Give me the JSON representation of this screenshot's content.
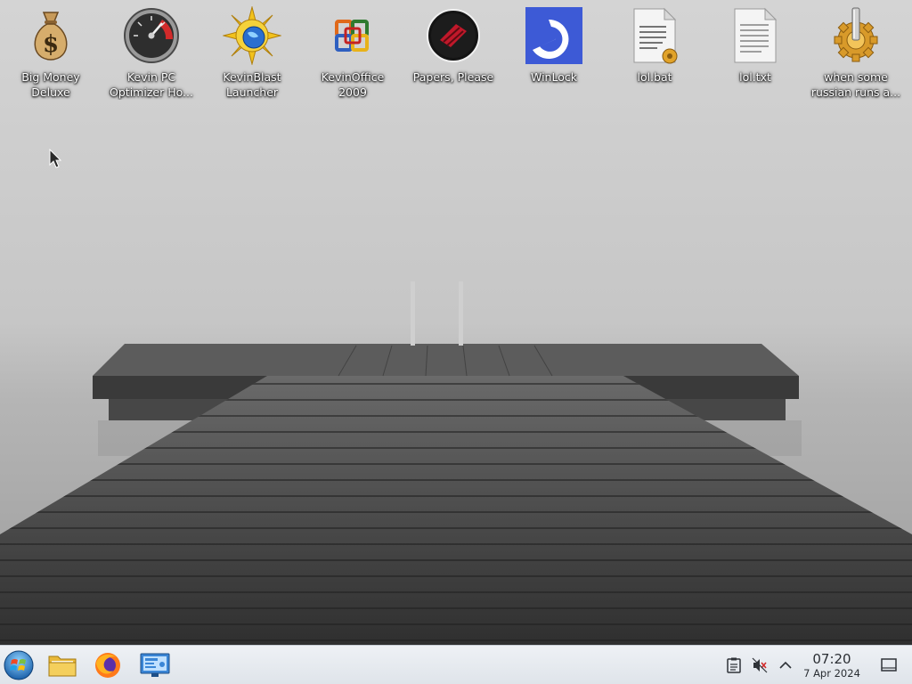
{
  "desktop": {
    "icons": [
      {
        "label": "Big Money\nDeluxe",
        "icon": "money-bag-icon"
      },
      {
        "label": "Kevin PC\nOptimizer Ho...",
        "icon": "speedometer-icon"
      },
      {
        "label": "KevinBlast\nLauncher",
        "icon": "sun-globe-icon"
      },
      {
        "label": "KevinOffice\n2009",
        "icon": "office-squares-icon"
      },
      {
        "label": "Papers, Please",
        "icon": "papers-please-seal-icon"
      },
      {
        "label": "WinLock",
        "icon": "winlock-icon"
      },
      {
        "label": "lol.bat",
        "icon": "batch-file-icon"
      },
      {
        "label": "lol.txt",
        "icon": "text-file-icon"
      },
      {
        "label": "when some\nrussian runs a...",
        "icon": "gear-icon"
      }
    ]
  },
  "taskbar": {
    "pinned": [
      {
        "name": "start-button",
        "icon": "windows-orb-icon"
      },
      {
        "name": "file-manager-button",
        "icon": "folder-icon"
      },
      {
        "name": "firefox-button",
        "icon": "firefox-icon"
      },
      {
        "name": "remote-desktop-button",
        "icon": "monitor-icon"
      }
    ],
    "tray": {
      "clipboard_icon": "clipboard-icon",
      "volume_icon": "volume-muted-icon",
      "expand_icon": "chevron-up-icon",
      "show_desktop_icon": "show-desktop-icon"
    },
    "clock": {
      "time": "07:20",
      "date": "7 Apr 2024"
    }
  },
  "colors": {
    "taskbar_bg": "#e4e8ed",
    "icon_text": "#ffffff",
    "winlock_blue": "#3d5ad6",
    "papers_red": "#c0182a"
  }
}
